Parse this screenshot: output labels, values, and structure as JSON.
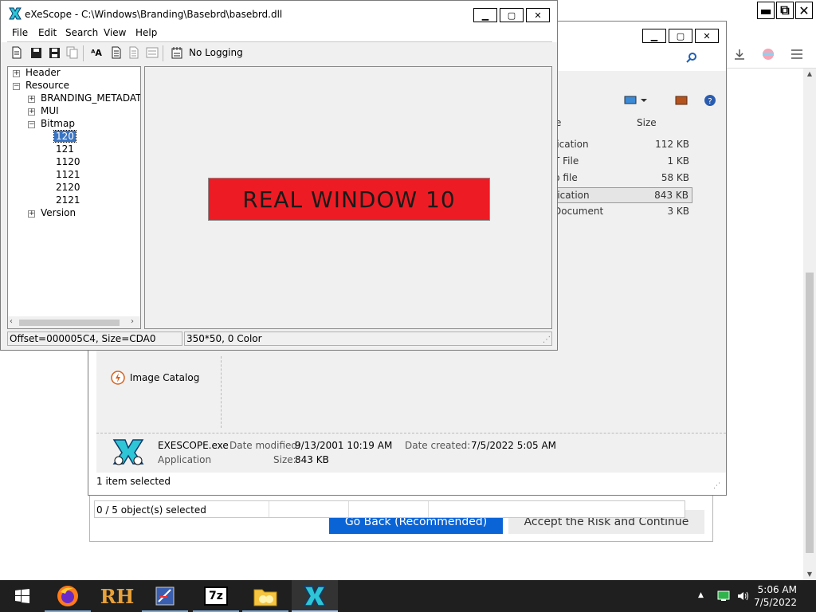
{
  "browser": {
    "controls": {
      "minimize": "▬",
      "restore": "⧉",
      "close": "✕"
    }
  },
  "background_dialog": {
    "go_back_label": "Go Back (Recommended)",
    "accept_label": "Accept the Risk and Continue"
  },
  "explorer": {
    "columns": {
      "type": "e",
      "size": "Size"
    },
    "files": [
      {
        "type": "lication",
        "size": "112 KB",
        "selected": false
      },
      {
        "type": "T File",
        "size": "1 KB",
        "selected": false
      },
      {
        "type": "p file",
        "size": "58 KB",
        "selected": false
      },
      {
        "type": "lication",
        "size": "843 KB",
        "selected": true
      },
      {
        "type": "Document",
        "size": "3 KB",
        "selected": false
      }
    ],
    "image_catalog_label": "Image Catalog",
    "details": {
      "name": "EXESCOPE.exe",
      "type": "Application",
      "date_modified_label": "Date modified:",
      "date_modified": "9/13/2001 10:19 AM",
      "date_created_label": "Date created:",
      "date_created": "7/5/2022 5:05 AM",
      "size_label": "Size:",
      "size": "843 KB"
    },
    "status": "1 item selected",
    "objects_status": "0 / 5 object(s) selected"
  },
  "exescope": {
    "title": "eXeScope - C:\\Windows\\Branding\\Basebrd\\basebrd.dll",
    "menu": [
      "File",
      "Edit",
      "Search",
      "View",
      "Help"
    ],
    "logging_label": "No Logging",
    "tree": {
      "header": "Header",
      "resource": "Resource",
      "branding": "BRANDING_METADATA_",
      "mui": "MUI",
      "bitmap": "Bitmap",
      "bitmap_items": [
        "120",
        "121",
        "1120",
        "1121",
        "2120",
        "2121"
      ],
      "version": "Version"
    },
    "bitmap_text": "REAL WINDOW 10",
    "status_offset": "Offset=000005C4, Size=CDA0",
    "status_info": "350*50, 0 Color"
  },
  "taskbar": {
    "time": "5:06 AM",
    "date": "7/5/2022",
    "apps": [
      "start-button",
      "firefox",
      "reshacker",
      "resource-editor",
      "7zip",
      "file-explorer",
      "exescope"
    ]
  },
  "colors": {
    "bitmap_red": "#ed1c24",
    "accent_blue": "#0a64d6",
    "taskbar": "#1f1f1f",
    "selection": "#3a75c4"
  }
}
